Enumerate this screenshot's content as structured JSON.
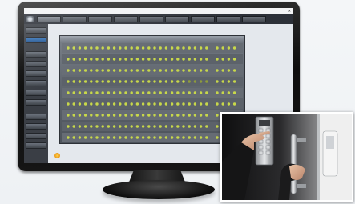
{
  "window": {
    "title": "",
    "close_glyph": "✕"
  },
  "tabs": [
    {
      "label": "",
      "active": true
    },
    {
      "label": "",
      "active": false
    },
    {
      "label": "",
      "active": false
    },
    {
      "label": "",
      "active": false
    },
    {
      "label": "",
      "active": false
    },
    {
      "label": "",
      "active": false
    },
    {
      "label": "",
      "active": false
    },
    {
      "label": "",
      "active": false
    },
    {
      "label": "",
      "active": false
    }
  ],
  "sidebar": {
    "items": [
      {
        "label": "",
        "active": false
      },
      {
        "label": "",
        "active": true
      },
      {
        "label": "",
        "active": false
      },
      {
        "label": "",
        "active": false
      },
      {
        "label": "",
        "active": false
      },
      {
        "label": "",
        "active": false
      },
      {
        "label": "",
        "active": false
      },
      {
        "label": "",
        "active": false
      },
      {
        "label": "",
        "active": false
      },
      {
        "label": "",
        "active": false
      },
      {
        "label": "",
        "active": false
      },
      {
        "label": "",
        "active": false
      }
    ]
  },
  "door_grid": {
    "header_left": "",
    "header_right": "",
    "rows": 9,
    "left_block_columns": 25,
    "right_block_columns": 4,
    "indicator_color": "#c8d84a",
    "dim_indicator_color": "#8e9b3c"
  },
  "brand": {
    "name": "",
    "sub": ""
  },
  "colors": {
    "monitor_bezel": "#111111",
    "app_chrome": "#2c3038",
    "accent": "#1f4f8a"
  }
}
